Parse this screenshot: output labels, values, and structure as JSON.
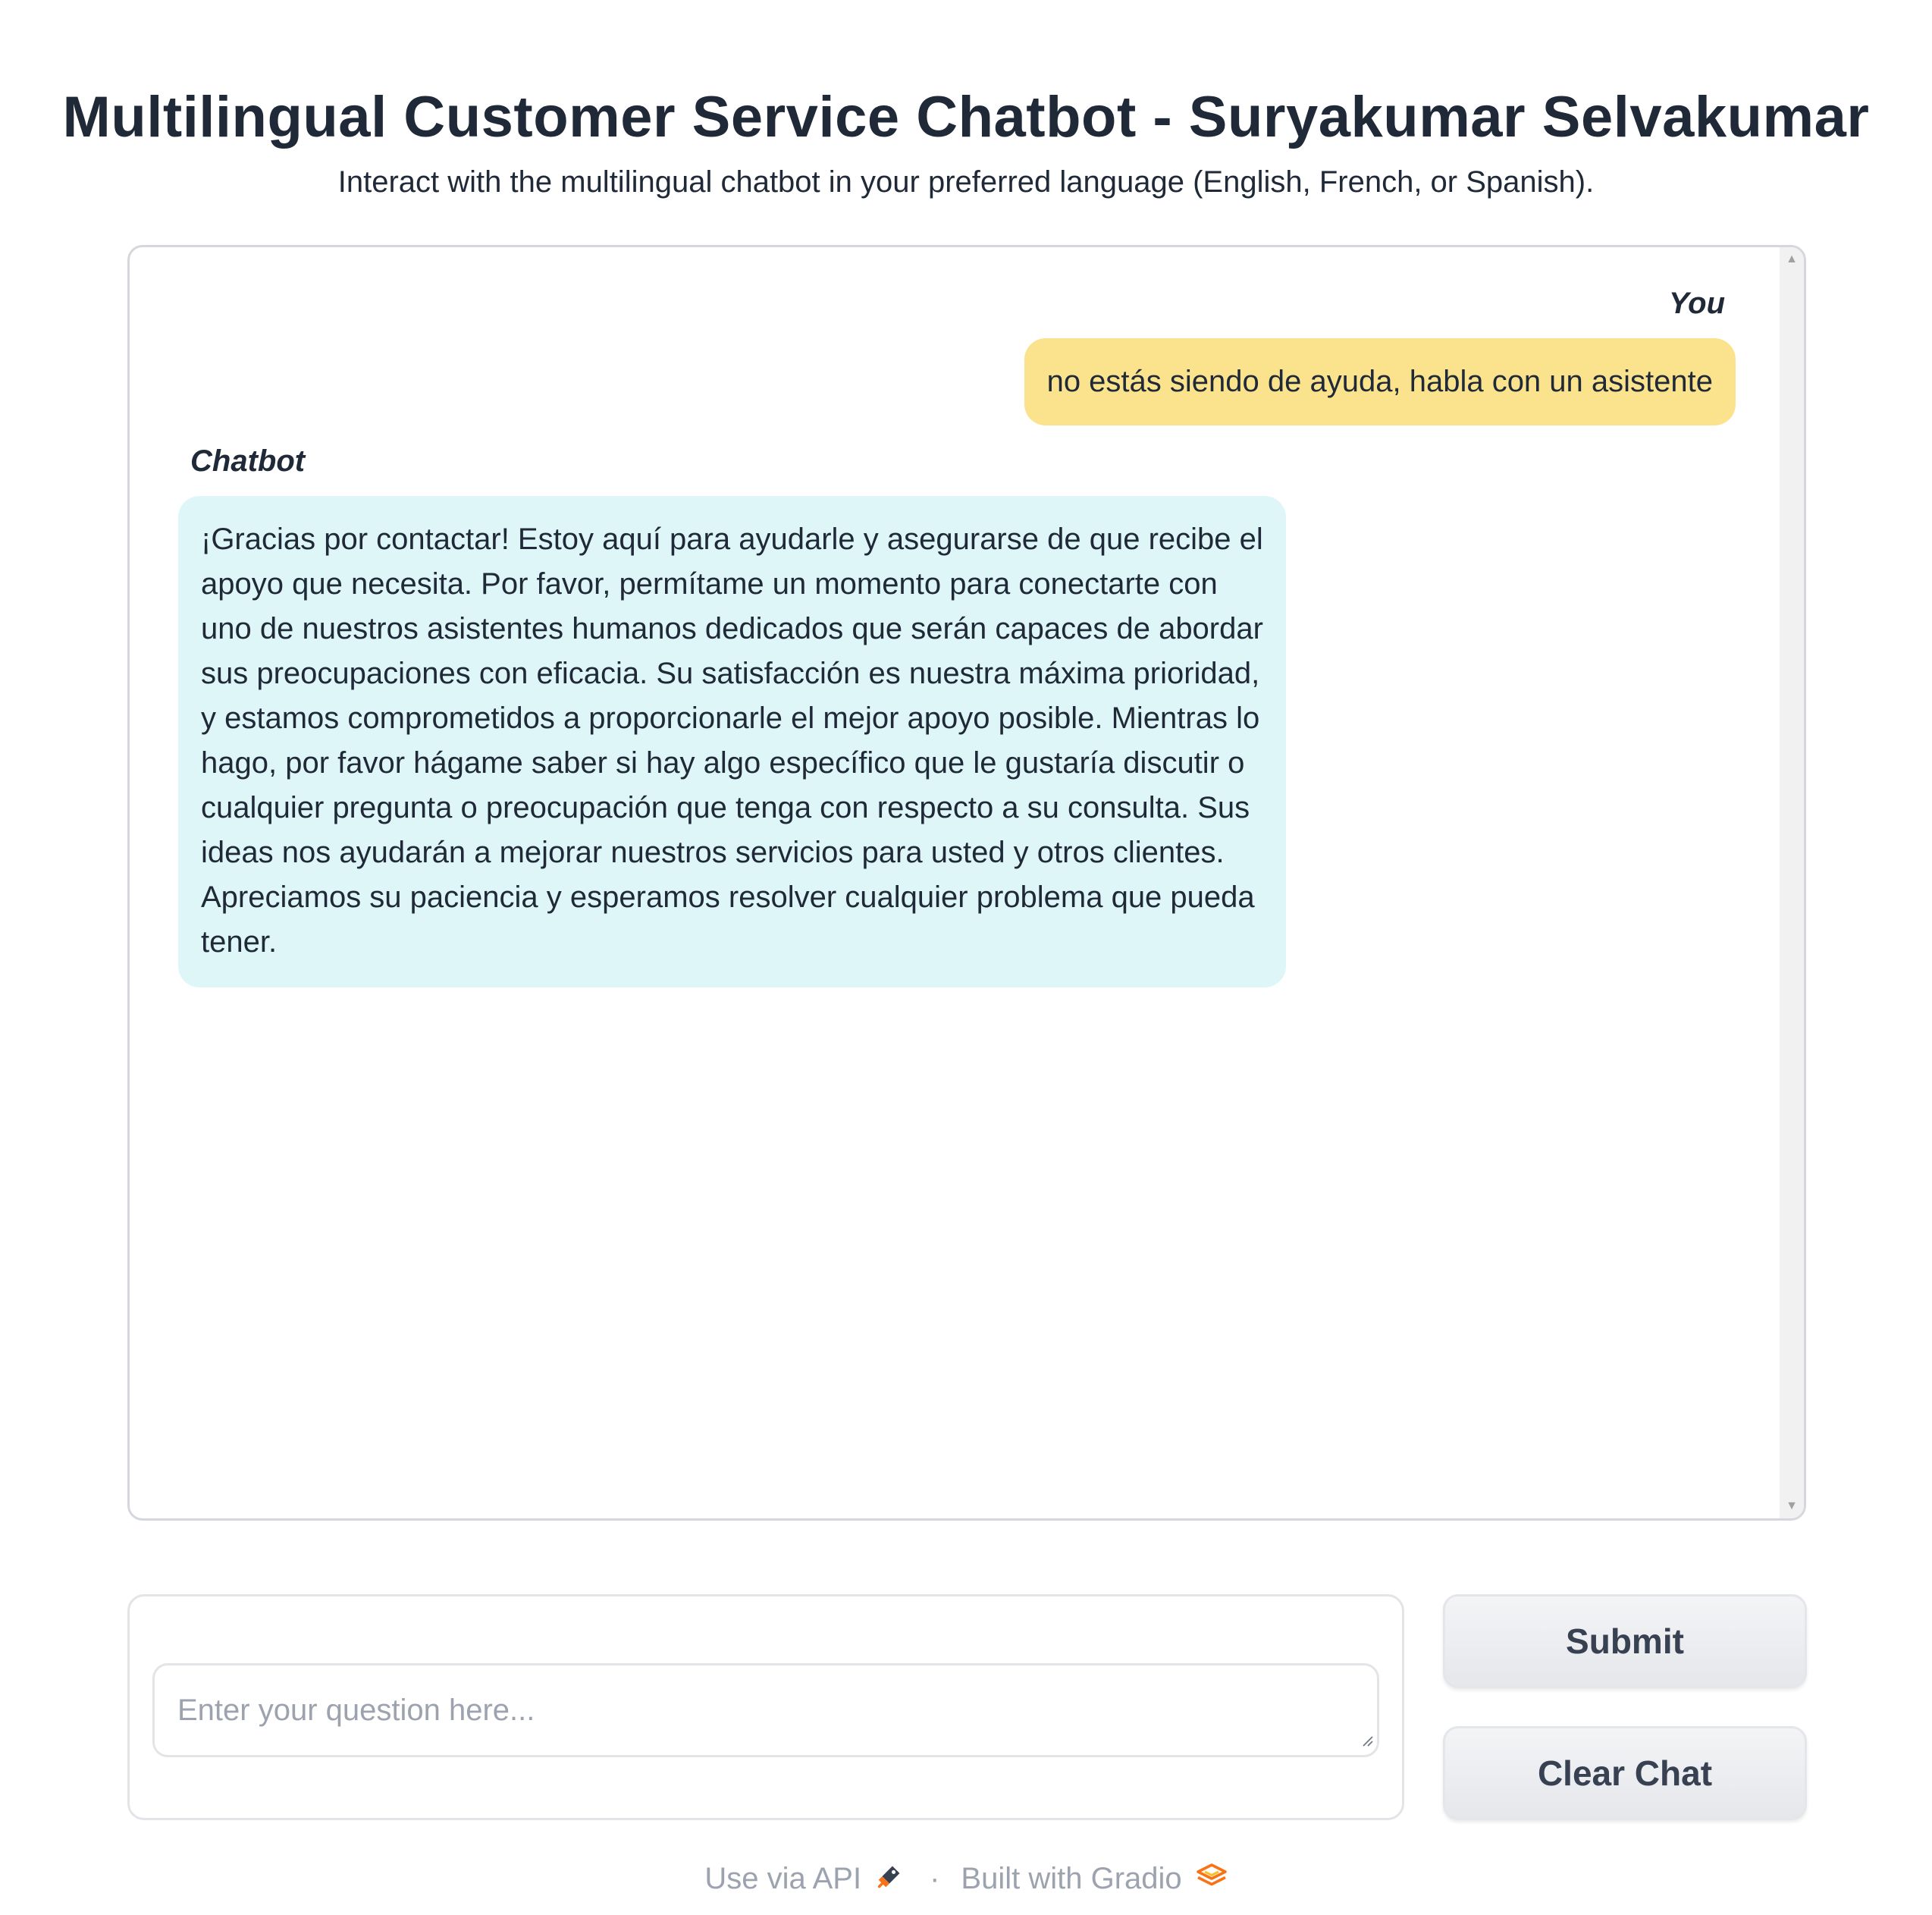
{
  "header": {
    "title": "Multilingual Customer Service Chatbot - Suryakumar Selvakumar",
    "description": "Interact with the multilingual chatbot in your preferred language (English, French, or Spanish)."
  },
  "chat": {
    "messages": [
      {
        "role_label": "You",
        "text": "no estás siendo de ayuda, habla con un asistente"
      },
      {
        "role_label": "Chatbot",
        "text": "¡Gracias por contactar! Estoy aquí para ayudarle y asegurarse de que recibe el apoyo que necesita. Por favor, permítame un momento para conectarte con uno de nuestros asistentes humanos dedicados que serán capaces de abordar sus preocupaciones con eficacia. Su satisfacción es nuestra máxima prioridad, y estamos comprometidos a proporcionarle el mejor apoyo posible. Mientras lo hago, por favor hágame saber si hay algo específico que le gustaría discutir o cualquier pregunta o preocupación que tenga con respecto a su consulta. Sus ideas nos ayudarán a mejorar nuestros servicios para usted y otros clientes. Apreciamos su paciencia y esperamos resolver cualquier problema que pueda tener."
      }
    ]
  },
  "input": {
    "value": "",
    "placeholder": "Enter your question here..."
  },
  "buttons": {
    "submit_label": "Submit",
    "clear_label": "Clear Chat"
  },
  "footer": {
    "api_label": "Use via API",
    "separator": "·",
    "built_label": "Built with Gradio"
  },
  "colors": {
    "user_bubble": "#fbe38e",
    "bot_bubble": "#dff6f8",
    "text": "#1f2937",
    "muted": "#9ca3af",
    "gradio_orange": "#f97316"
  },
  "icons": {
    "api": "rocket-icon",
    "gradio": "gradio-logo-icon",
    "scroll_up": "scroll-up-arrow-icon",
    "scroll_down": "scroll-down-arrow-icon"
  }
}
